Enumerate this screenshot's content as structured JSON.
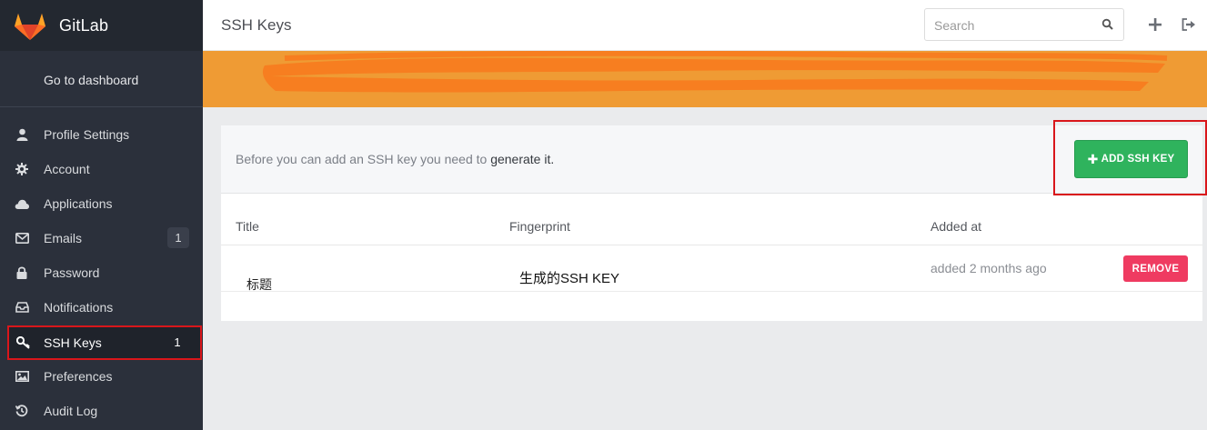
{
  "app": {
    "name": "GitLab"
  },
  "sidebar": {
    "dashboard_label": "Go to dashboard",
    "items": [
      {
        "label": "Profile Settings",
        "icon": "user-icon",
        "badge": null
      },
      {
        "label": "Account",
        "icon": "gear-icon",
        "badge": null
      },
      {
        "label": "Applications",
        "icon": "cloud-icon",
        "badge": null
      },
      {
        "label": "Emails",
        "icon": "envelope-icon",
        "badge": "1"
      },
      {
        "label": "Password",
        "icon": "lock-icon",
        "badge": null
      },
      {
        "label": "Notifications",
        "icon": "inbox-icon",
        "badge": null
      },
      {
        "label": "SSH Keys",
        "icon": "key-icon",
        "badge": "1",
        "active": true
      },
      {
        "label": "Preferences",
        "icon": "image-icon",
        "badge": null
      },
      {
        "label": "Audit Log",
        "icon": "history-icon",
        "badge": null
      }
    ]
  },
  "header": {
    "title": "SSH Keys",
    "search_placeholder": "Search"
  },
  "notice": {
    "text": "Before you can add an SSH key you need to ",
    "link": "generate it."
  },
  "add_button": {
    "label": "ADD SSH KEY"
  },
  "table": {
    "columns": [
      "Title",
      "Fingerprint",
      "Added at"
    ],
    "rows": [
      {
        "title": "标题",
        "fingerprint": "生成的SSH KEY",
        "added_at": "added 2 months ago",
        "action": "REMOVE"
      }
    ]
  },
  "colors": {
    "sidebar_bg": "#2b303b",
    "banner": "#ef9b34",
    "add_button": "#2fb35d",
    "remove_button": "#ef3b61",
    "highlight_border": "#d9161b"
  }
}
